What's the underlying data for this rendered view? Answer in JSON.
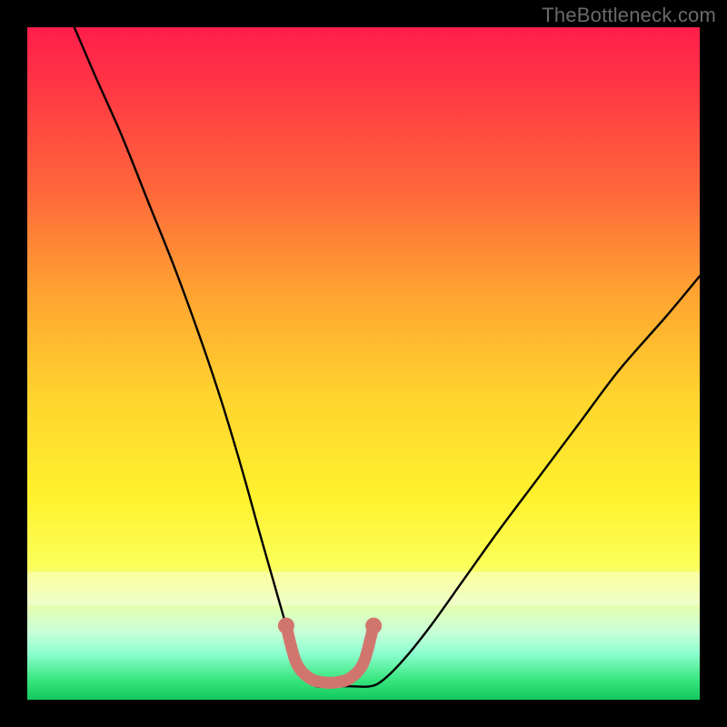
{
  "watermark": "TheBottleneck.com",
  "chart_data": {
    "type": "line",
    "title": "",
    "xlabel": "",
    "ylabel": "",
    "xlim": [
      0,
      100
    ],
    "ylim": [
      0,
      100
    ],
    "series": [
      {
        "name": "bottleneck-curve",
        "x": [
          7,
          10,
          14,
          18,
          22,
          26,
          29,
          32,
          34.5,
          36.5,
          38.5,
          40,
          41.5,
          43,
          45,
          48,
          51,
          53,
          56,
          60,
          65,
          70,
          76,
          82,
          88,
          95,
          100
        ],
        "y": [
          100,
          93,
          84,
          74,
          64,
          53,
          44,
          34,
          25,
          18,
          11,
          6,
          3,
          2,
          2,
          2,
          2,
          3,
          6,
          11,
          18,
          25,
          33,
          41,
          49,
          57,
          63
        ]
      },
      {
        "name": "optimal-band",
        "x": [
          38.5,
          40,
          42,
          44,
          46,
          48,
          50,
          51.5
        ],
        "y": [
          11,
          5.5,
          3.2,
          2.6,
          2.6,
          3.2,
          5.5,
          11
        ]
      }
    ],
    "optimal_marker_color": "#d1766e",
    "curve_color": "#000000"
  }
}
